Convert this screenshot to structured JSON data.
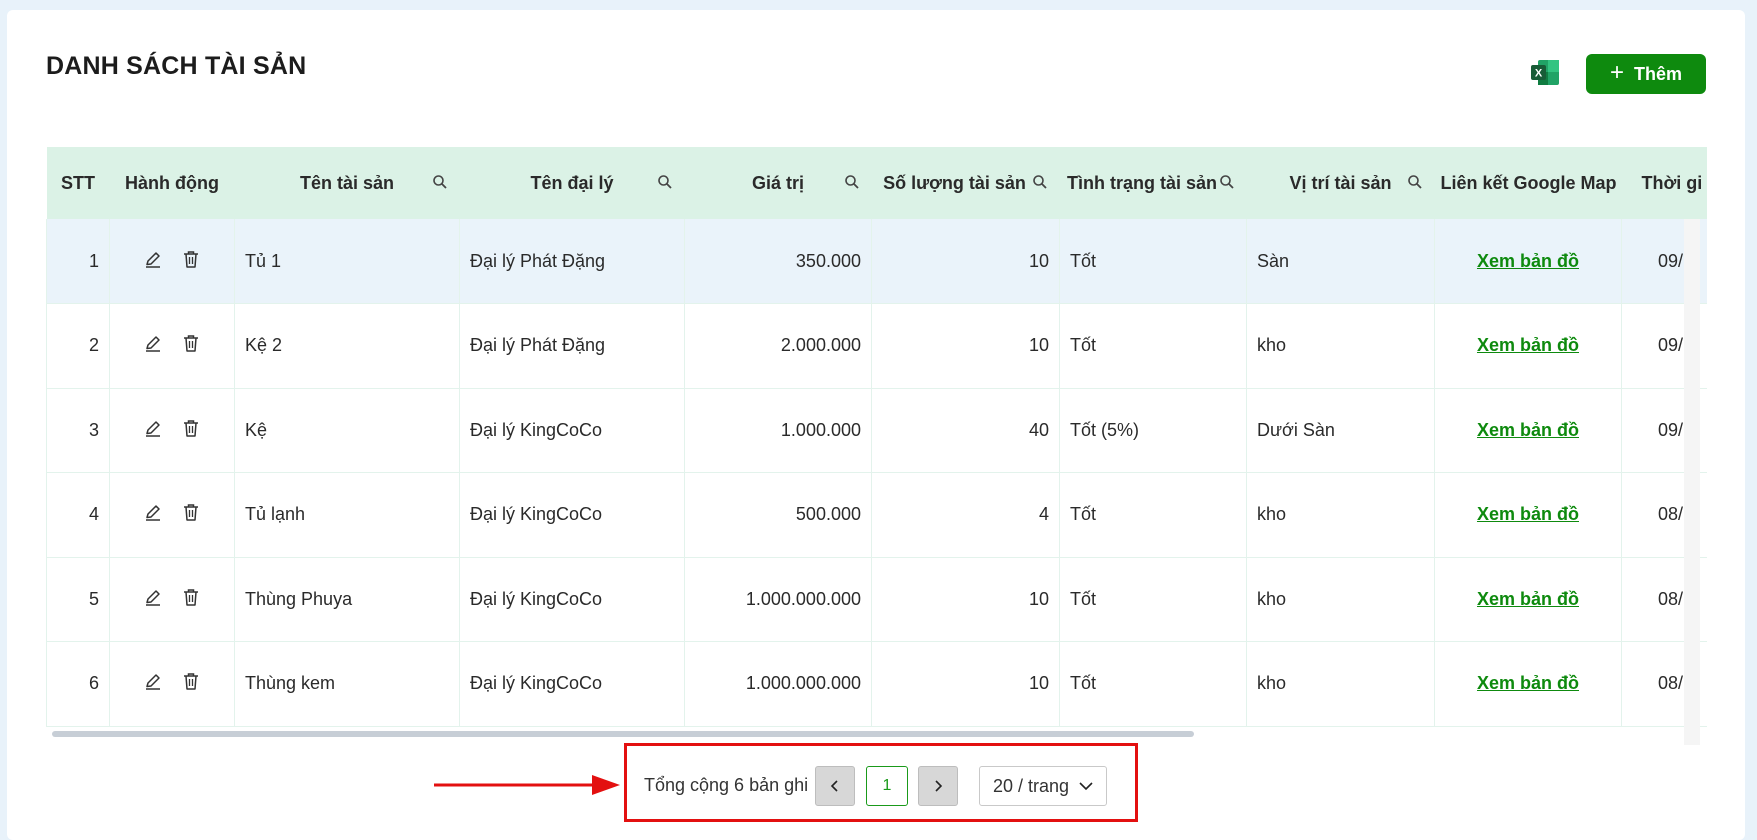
{
  "page": {
    "title": "DANH SÁCH TÀI SẢN"
  },
  "toolbar": {
    "excel_icon": "excel-icon",
    "add_label": "Thêm"
  },
  "table": {
    "columns": [
      "STT",
      "Hành động",
      "Tên tài sản",
      "Tên đại lý",
      "Giá trị",
      "Số lượng tài sản",
      "Tình trạng tài sản",
      "Vị trí tài sản",
      "Liên kết Google Map",
      "Thời gi"
    ],
    "rows": [
      {
        "stt": "1",
        "name": "Tủ 1",
        "agent": "Đại lý Phát Đặng",
        "value": "350.000",
        "qty": "10",
        "status": "Tốt",
        "location": "Sàn",
        "map": "Xem bản đồ",
        "time": "09/"
      },
      {
        "stt": "2",
        "name": "Kệ 2",
        "agent": "Đại lý Phát Đặng",
        "value": "2.000.000",
        "qty": "10",
        "status": "Tốt",
        "location": "kho",
        "map": "Xem bản đồ",
        "time": "09/"
      },
      {
        "stt": "3",
        "name": "Kệ",
        "agent": "Đại lý KingCoCo",
        "value": "1.000.000",
        "qty": "40",
        "status": "Tốt (5%)",
        "location": "Dưới Sàn",
        "map": "Xem bản đồ",
        "time": "09/"
      },
      {
        "stt": "4",
        "name": "Tủ lạnh",
        "agent": "Đại lý KingCoCo",
        "value": "500.000",
        "qty": "4",
        "status": "Tốt",
        "location": "kho",
        "map": "Xem bản đồ",
        "time": "08/"
      },
      {
        "stt": "5",
        "name": "Thùng Phuya",
        "agent": "Đại lý KingCoCo",
        "value": "1.000.000.000",
        "qty": "10",
        "status": "Tốt",
        "location": "kho",
        "map": "Xem bản đồ",
        "time": "08/"
      },
      {
        "stt": "6",
        "name": "Thùng kem",
        "agent": "Đại lý KingCoCo",
        "value": "1.000.000.000",
        "qty": "10",
        "status": "Tốt",
        "location": "kho",
        "map": "Xem bản đồ",
        "time": "08/"
      }
    ]
  },
  "pagination": {
    "total_text": "Tổng cộng 6 bản ghi",
    "prev": "<",
    "current": "1",
    "next": ">",
    "page_size": "20 / trang"
  },
  "colors": {
    "primary_green": "#0e8a0e",
    "header_bg": "#dbf2e6",
    "highlight_row": "#eaf3fa",
    "annotation_red": "#e31010"
  }
}
